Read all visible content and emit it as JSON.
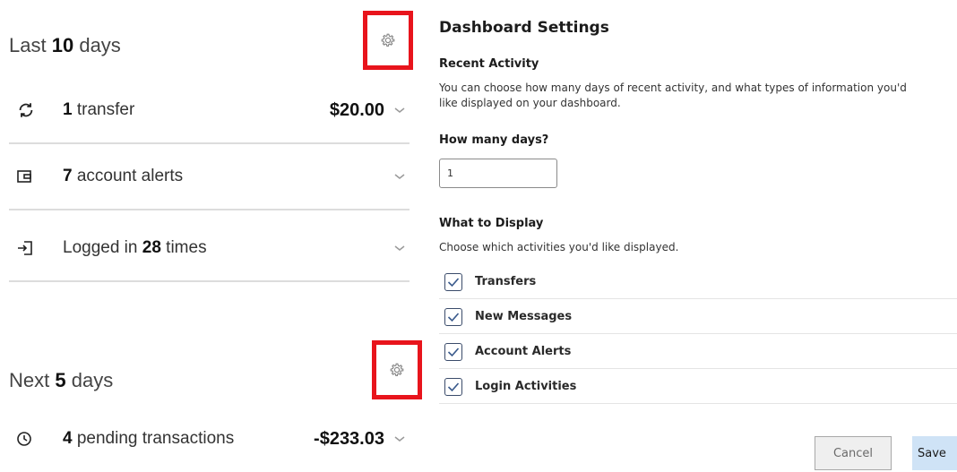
{
  "left": {
    "last": {
      "prefix": "Last",
      "count": "10",
      "suffix": "days"
    },
    "rows": [
      {
        "count": "1",
        "label": "transfer",
        "amount": "$20.00"
      },
      {
        "count": "7",
        "label": "account alerts"
      },
      {
        "prefix": "Logged in",
        "count": "28",
        "suffix": "times"
      }
    ],
    "next": {
      "prefix": "Next",
      "count": "5",
      "suffix": "days"
    },
    "pending": {
      "count": "4",
      "label": "pending transactions",
      "amount": "-$233.03"
    }
  },
  "settings": {
    "title": "Dashboard Settings",
    "recent_heading": "Recent Activity",
    "recent_desc": "You can choose how many days of recent activity, and what types of information you'd like displayed on your dashboard.",
    "days_label": "How many days?",
    "days_value": "1",
    "display_heading": "What to Display",
    "display_desc": "Choose which activities you'd like displayed.",
    "options": [
      {
        "label": "Transfers",
        "checked": true
      },
      {
        "label": "New Messages",
        "checked": true
      },
      {
        "label": "Account Alerts",
        "checked": true
      },
      {
        "label": "Login Activities",
        "checked": true
      }
    ],
    "cancel_label": "Cancel",
    "save_label": "Save"
  },
  "colors": {
    "highlight": "#e8141c",
    "checkbox_border": "#3a4b6a",
    "save_bg": "#cfe3f6"
  },
  "icons": [
    "gear-icon",
    "refresh-icon",
    "wallet-icon",
    "login-icon",
    "clock-icon",
    "chevron-down-icon",
    "checkmark-icon"
  ]
}
